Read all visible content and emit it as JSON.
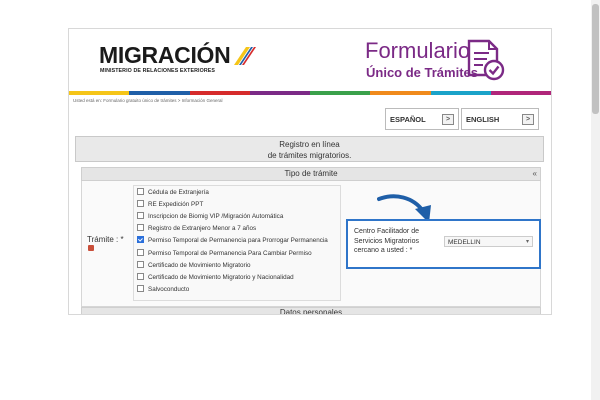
{
  "header": {
    "logo_text": "MIGRACIÓN",
    "logo_subtitle": "MINISTERIO DE RELACIONES EXTERIORES",
    "form_title_line1": "Formulario",
    "form_title_line2": "Único de Trámites",
    "form_icon": "document-check-icon"
  },
  "breadcrumb": "Usted está en: Formulario gratuito único de trámites > Información General",
  "languages": {
    "es": "ESPAÑOL",
    "en": "ENGLISH",
    "arrow": ">"
  },
  "section_registro": {
    "line1": "Registro en línea",
    "line2": "de trámites migratorios."
  },
  "tipo_tramite": {
    "heading": "Tipo de trámite",
    "collapse_glyph": "«",
    "label": "Trámite : *",
    "options": [
      {
        "label": "Cédula de Extranjería",
        "checked": false
      },
      {
        "label": "RE Expedición PPT",
        "checked": false
      },
      {
        "label": "Inscripcion de Biomig VIP /Migración Automática",
        "checked": false
      },
      {
        "label": "Registro de Extranjero Menor a 7 años",
        "checked": false
      },
      {
        "label": "Permiso Temporal de Permanencia para Prorrogar Permanencia",
        "checked": true
      },
      {
        "label": "Permiso Temporal de Permanencia Para Cambiar Permiso",
        "checked": false
      },
      {
        "label": "Certificado de Movimiento Migratorio",
        "checked": false
      },
      {
        "label": "Certificado de Movimiento Migratorio y Nacionalidad",
        "checked": false
      },
      {
        "label": "Salvoconducto",
        "checked": false
      }
    ]
  },
  "centro": {
    "label": "Centro Facilitador de Servicios Migratorios cercano a usted : *",
    "selected": "MEDELLIN",
    "chevron": "▾"
  },
  "datos_personales": {
    "heading": "Datos personales"
  },
  "colors": {
    "brand_purple": "#7b2a86",
    "accent_blue": "#2f75c9",
    "color_bar": [
      "#f5c518",
      "#1f5fa8",
      "#d62b2b",
      "#7b2a86",
      "#3aa14b",
      "#f08a1c",
      "#1aa3c9",
      "#b0257a"
    ]
  }
}
